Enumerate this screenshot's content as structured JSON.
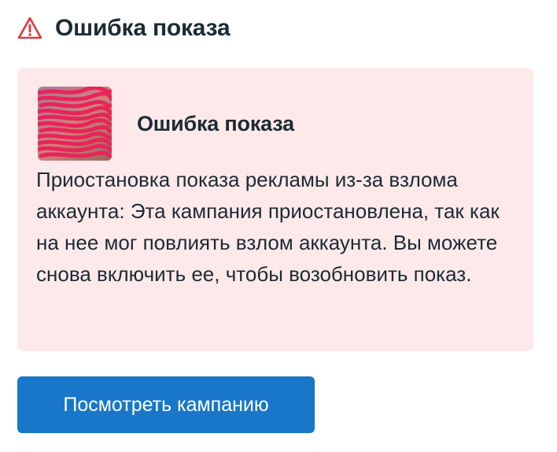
{
  "header": {
    "icon": "warning-triangle-icon",
    "title": "Ошибка показа"
  },
  "card": {
    "background_color": "#fde9ea",
    "avatar": "redacted-avatar",
    "title": "Ошибка показа",
    "body": "Приостановка показа рекламы из-за взлома аккаунта: Эта кампания приостановлена, так как на нее мог повлиять взлом аккаунта. Вы можете снова включить ее, чтобы возобновить показ."
  },
  "actions": {
    "view_campaign_label": "Посмотреть кампанию",
    "button_color": "#1877c8"
  },
  "colors": {
    "warning": "#e0393e",
    "text": "#1c2b33",
    "redaction": "#e8245a"
  }
}
